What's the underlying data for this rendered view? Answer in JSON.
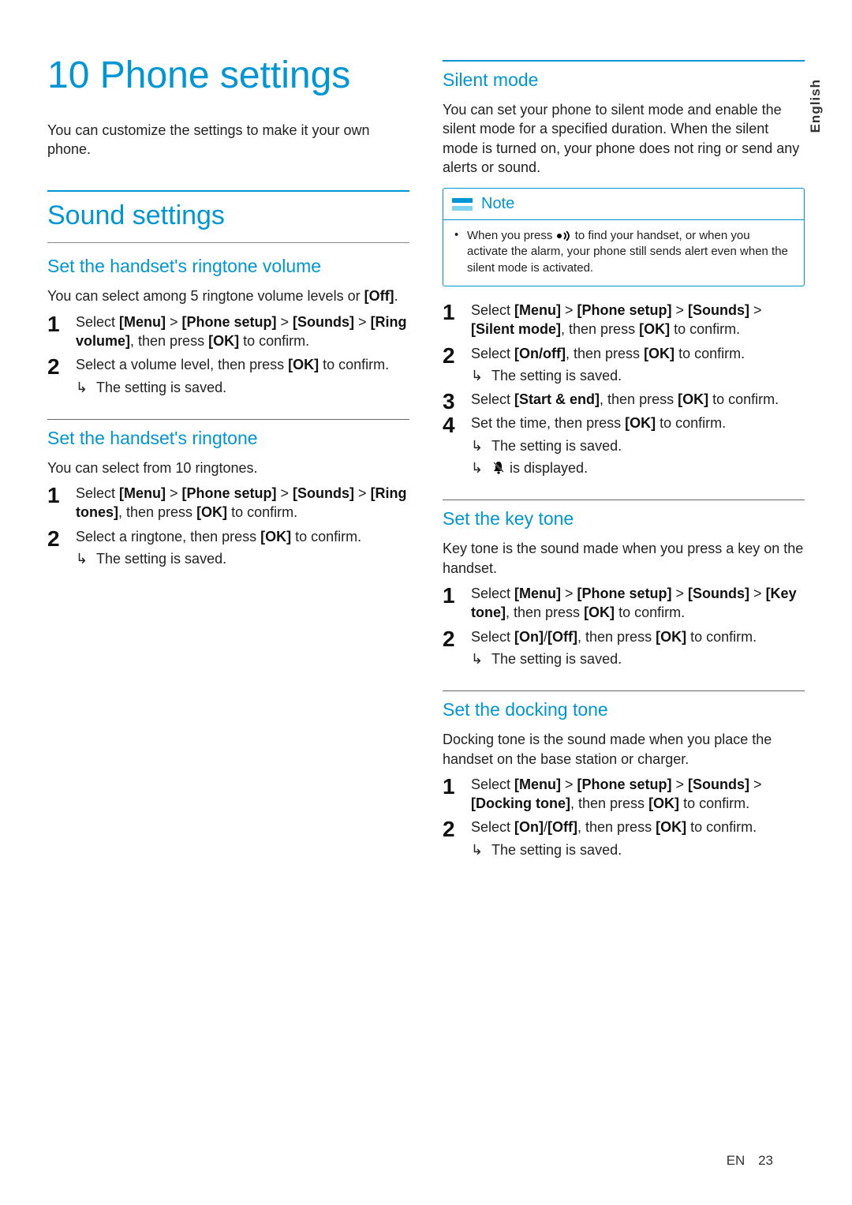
{
  "language_tab": "English",
  "footer": {
    "lang": "EN",
    "page": "23"
  },
  "chapter": {
    "number": "10",
    "title": "Phone settings"
  },
  "intro": "You can customize the settings to make it your own phone.",
  "section_sound": {
    "title": "Sound settings",
    "ringtone_volume": {
      "title": "Set the handset's ringtone volume",
      "intro_a": "You can select among 5 ringtone volume levels or ",
      "intro_b": "[Off]",
      "intro_c": ".",
      "step1_a": "Select ",
      "step1_b": "[Menu]",
      "step1_c": " > ",
      "step1_d": "[Phone setup]",
      "step1_e": " > ",
      "step1_f": "[Sounds]",
      "step1_g": " > ",
      "step1_h": "[Ring volume]",
      "step1_i": ", then press ",
      "step1_j": "[OK]",
      "step1_k": " to confirm.",
      "step2_a": "Select a volume level, then press ",
      "step2_b": "[OK]",
      "step2_c": " to confirm.",
      "result": "The setting is saved."
    },
    "ringtone": {
      "title": "Set the handset's ringtone",
      "intro": "You can select from 10 ringtones.",
      "step1_a": "Select ",
      "step1_b": "[Menu]",
      "step1_c": " > ",
      "step1_d": "[Phone setup]",
      "step1_e": " > ",
      "step1_f": "[Sounds]",
      "step1_g": " > ",
      "step1_h": "[Ring tones]",
      "step1_i": ", then press ",
      "step1_j": "[OK]",
      "step1_k": " to confirm.",
      "step2_a": "Select a ringtone, then press ",
      "step2_b": "[OK]",
      "step2_c": " to confirm.",
      "result": "The setting is saved."
    },
    "silent_mode": {
      "title": "Silent mode",
      "intro": "You can set your phone to silent mode and enable the silent mode for a specified duration. When the silent mode is turned on, your phone does not ring or send any alerts or sound.",
      "note_label": "Note",
      "note_a": "When you press ",
      "note_b": " to find your handset, or when you activate the alarm, your phone still sends alert even when the silent mode is activated.",
      "step1_a": "Select ",
      "step1_b": "[Menu]",
      "step1_c": " > ",
      "step1_d": "[Phone setup]",
      "step1_e": " > ",
      "step1_f": "[Sounds]",
      "step1_g": " > ",
      "step1_h": "[Silent mode]",
      "step1_i": ", then press ",
      "step1_j": "[OK]",
      "step1_k": " to confirm.",
      "step2_a": "Select ",
      "step2_b": "[On/off]",
      "step2_c": ", then press ",
      "step2_d": "[OK]",
      "step2_e": " to confirm.",
      "step2_result": "The setting is saved.",
      "step3_a": "Select ",
      "step3_b": "[Start & end]",
      "step3_c": ", then press ",
      "step3_d": "[OK]",
      "step3_e": " to confirm.",
      "step4_a": "Set the time, then press ",
      "step4_b": "[OK]",
      "step4_c": " to confirm.",
      "step4_result1": "The setting is saved.",
      "step4_result2": " is displayed."
    },
    "key_tone": {
      "title": "Set the key tone",
      "intro": "Key tone is the sound made when you press a key on the handset.",
      "step1_a": "Select ",
      "step1_b": "[Menu]",
      "step1_c": " > ",
      "step1_d": "[Phone setup]",
      "step1_e": " > ",
      "step1_f": "[Sounds]",
      "step1_g": " > ",
      "step1_h": "[Key tone]",
      "step1_i": ", then press ",
      "step1_j": "[OK]",
      "step1_k": " to confirm.",
      "step2_a": "Select ",
      "step2_b": "[On]",
      "step2_c": "/",
      "step2_d": "[Off]",
      "step2_e": ", then press ",
      "step2_f": "[OK]",
      "step2_g": " to confirm.",
      "result": "The setting is saved."
    },
    "docking_tone": {
      "title": "Set the docking tone",
      "intro": "Docking tone is the sound made when you place the handset on the base station or charger.",
      "step1_a": "Select ",
      "step1_b": "[Menu]",
      "step1_c": " > ",
      "step1_d": "[Phone setup]",
      "step1_e": " > ",
      "step1_f": "[Sounds]",
      "step1_g": " > ",
      "step1_h": "[Docking tone]",
      "step1_i": ", then press ",
      "step1_j": "[OK]",
      "step1_k": " to confirm.",
      "step2_a": "Select ",
      "step2_b": "[On]",
      "step2_c": "/",
      "step2_d": "[Off]",
      "step2_e": ", then press ",
      "step2_f": "[OK]",
      "step2_g": " to confirm.",
      "result": "The setting is saved."
    }
  }
}
